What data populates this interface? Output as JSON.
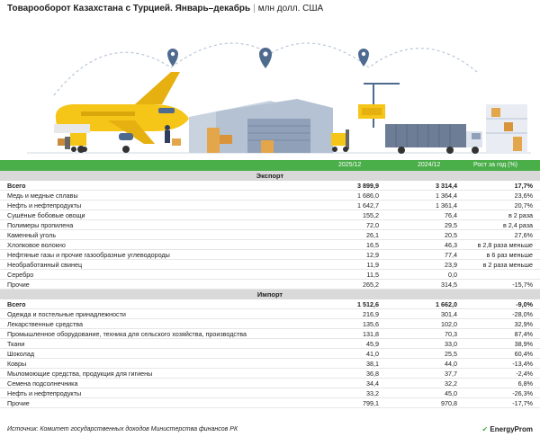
{
  "header": {
    "title_bold": "Товарооборот Казахстана с Турцией. Январь–декабрь",
    "separator": "|",
    "title_unit": "млн долл. США"
  },
  "columns": {
    "c1": "2025/12",
    "c2": "2024/12",
    "c3": "Рост за год (%)"
  },
  "sections": [
    {
      "label": "Экспорт",
      "rows": [
        {
          "name": "Всего",
          "v2025": "3 899,9",
          "v2024": "3 314,4",
          "growth": "17,7%",
          "total": true
        },
        {
          "name": "Медь и медные сплавы",
          "v2025": "1 686,0",
          "v2024": "1 364,4",
          "growth": "23,6%"
        },
        {
          "name": "Нефть и нефтепродукты",
          "v2025": "1 642,7",
          "v2024": "1 361,4",
          "growth": "20,7%"
        },
        {
          "name": "Сушёные бобовые овощи",
          "v2025": "155,2",
          "v2024": "76,4",
          "growth": "в 2 раза"
        },
        {
          "name": "Полимеры пропилена",
          "v2025": "72,0",
          "v2024": "29,5",
          "growth": "в 2,4 раза"
        },
        {
          "name": "Каменный уголь",
          "v2025": "26,1",
          "v2024": "20,5",
          "growth": "27,6%"
        },
        {
          "name": "Хлопковое волокно",
          "v2025": "16,5",
          "v2024": "46,3",
          "growth": "в 2,8 раза меньше"
        },
        {
          "name": "Нефтяные газы и прочие газообразные углеводороды",
          "v2025": "12,9",
          "v2024": "77,4",
          "growth": "в 6 раз меньше"
        },
        {
          "name": "Необработанный свинец",
          "v2025": "11,9",
          "v2024": "23,9",
          "growth": "в 2 раза меньше"
        },
        {
          "name": "Серебро",
          "v2025": "11,5",
          "v2024": "0,0",
          "growth": ""
        },
        {
          "name": "Прочие",
          "v2025": "265,2",
          "v2024": "314,5",
          "growth": "-15,7%"
        }
      ]
    },
    {
      "label": "Импорт",
      "rows": [
        {
          "name": "Всего",
          "v2025": "1 512,6",
          "v2024": "1 662,0",
          "growth": "-9,0%",
          "total": true
        },
        {
          "name": "Одежда и постельные принадлежности",
          "v2025": "216,9",
          "v2024": "301,4",
          "growth": "-28,0%"
        },
        {
          "name": "Лекарственные средства",
          "v2025": "135,6",
          "v2024": "102,0",
          "growth": "32,9%"
        },
        {
          "name": "Промышленное оборудование, техника для сельского хозяйства, производства",
          "v2025": "131,8",
          "v2024": "70,3",
          "growth": "87,4%"
        },
        {
          "name": "Ткани",
          "v2025": "45,9",
          "v2024": "33,0",
          "growth": "38,9%"
        },
        {
          "name": "Шоколад",
          "v2025": "41,0",
          "v2024": "25,5",
          "growth": "60,4%"
        },
        {
          "name": "Ковры",
          "v2025": "38,1",
          "v2024": "44,0",
          "growth": "-13,4%"
        },
        {
          "name": "Мыломоющие средства, продукция для гигиены",
          "v2025": "36,8",
          "v2024": "37,7",
          "growth": "-2,4%"
        },
        {
          "name": "Семена подсолнечника",
          "v2025": "34,4",
          "v2024": "32,2",
          "growth": "6,8%"
        },
        {
          "name": "Нефть и нефтепродукты",
          "v2025": "33,2",
          "v2024": "45,0",
          "growth": "-26,3%"
        },
        {
          "name": "Прочие",
          "v2025": "799,1",
          "v2024": "970,8",
          "growth": "-17,7%"
        }
      ]
    }
  ],
  "footer": {
    "source": "Источник: Комитет государственных доходов Министерства финансов РК",
    "logo_mark": "✔",
    "logo_text": "EnergyProm"
  },
  "colors": {
    "accent": "#4aae49",
    "section_bg": "#d9d9d9",
    "plane": "#f5c518",
    "pin": "#4f6a8f"
  }
}
